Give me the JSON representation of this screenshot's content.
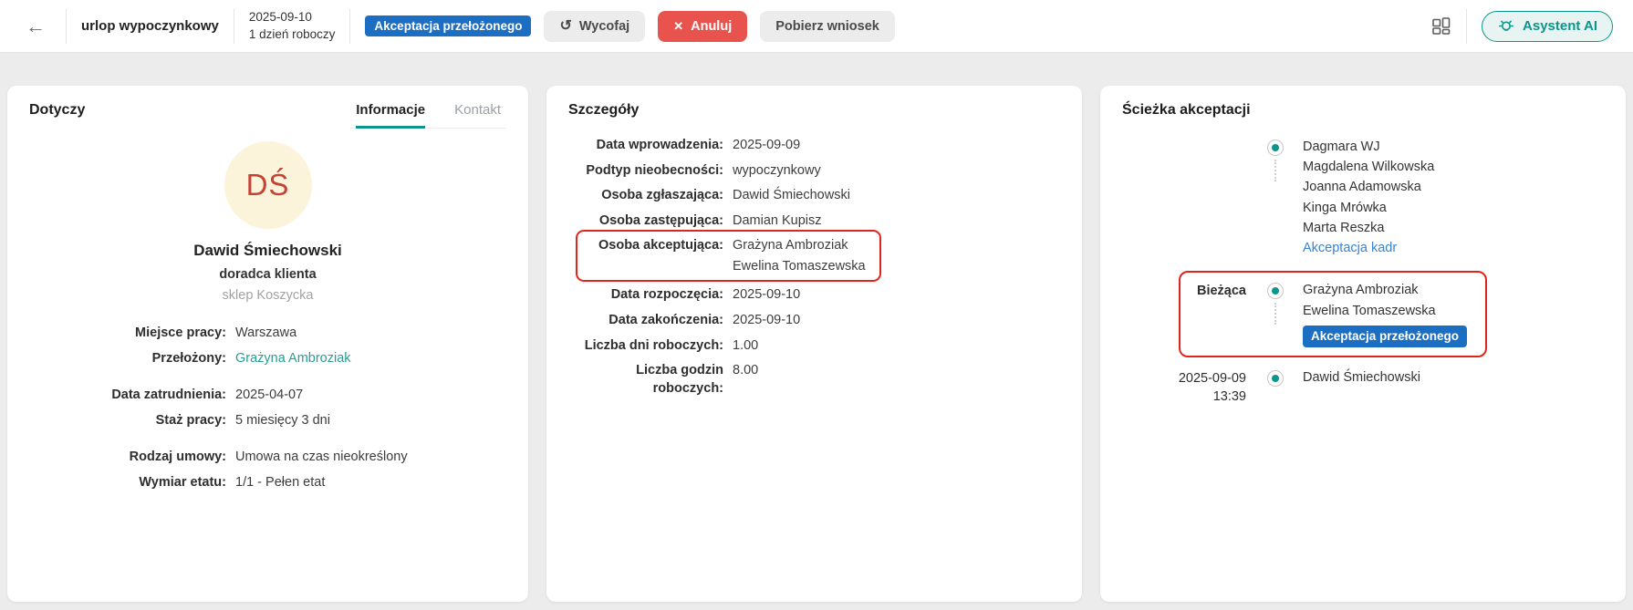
{
  "colors": {
    "accent_teal": "#0a968c",
    "badge_blue": "#1b6ec2",
    "link_blue": "#3583d6",
    "link_teal": "#2a9d93",
    "danger_red": "#e8534d",
    "annotation_red": "#e0261c",
    "avatar_bg": "#fbf3da",
    "avatar_text": "#c64234"
  },
  "topbar": {
    "back_icon": "←",
    "title": "urlop wypoczynkowy",
    "date": "2025-09-10",
    "duration": "1 dzień roboczy",
    "status_badge": "Akceptacja przełożonego",
    "withdraw_label": "Wycofaj",
    "withdraw_icon": "↺",
    "cancel_label": "Anuluj",
    "cancel_icon": "✕",
    "download_label": "Pobierz wniosek",
    "assistant_label": "Asystent AI"
  },
  "dotyczy": {
    "title": "Dotyczy",
    "tabs": [
      {
        "label": "Informacje",
        "active": true
      },
      {
        "label": "Kontakt",
        "active": false
      }
    ],
    "avatar_initials": "DŚ",
    "name": "Dawid Śmiechowski",
    "role": "doradca klienta",
    "unit": "sklep Koszycka",
    "groups": [
      [
        {
          "label": "Miejsce pracy:",
          "value": "Warszawa"
        },
        {
          "label": "Przełożony:",
          "value": "Grażyna Ambroziak",
          "link": true
        }
      ],
      [
        {
          "label": "Data zatrudnienia:",
          "value": "2025-04-07"
        },
        {
          "label": "Staż pracy:",
          "value": "5 miesięcy 3 dni"
        }
      ],
      [
        {
          "label": "Rodzaj umowy:",
          "value": "Umowa na czas nieokreślony"
        },
        {
          "label": "Wymiar etatu:",
          "value": "1/1 - Pełen etat"
        }
      ]
    ]
  },
  "szczegoly": {
    "title": "Szczegóły",
    "fields": [
      {
        "label": "Data wprowadzenia:",
        "value": "2025-09-09"
      },
      {
        "label": "Podtyp nieobecności:",
        "value": "wypoczynkowy"
      },
      {
        "label": "Osoba zgłaszająca:",
        "value": "Dawid Śmiechowski"
      },
      {
        "label": "Osoba zastępująca:",
        "value": "Damian Kupisz"
      },
      {
        "label": "Osoba akceptująca:",
        "value": "Grażyna Ambroziak",
        "value2": "Ewelina Tomaszewska",
        "highlighted": true
      },
      {
        "label": "Data rozpoczęcia:",
        "value": "2025-09-10"
      },
      {
        "label": "Data zakończenia:",
        "value": "2025-09-10"
      },
      {
        "label": "Liczba dni roboczych:",
        "value": "1.00"
      },
      {
        "label": "Liczba godzin roboczych:",
        "value": "8.00"
      }
    ]
  },
  "sciezka": {
    "title": "Ścieżka akceptacji",
    "steps": [
      {
        "label": "",
        "names": [
          "Dagmara WJ",
          "Magdalena Wilkowska",
          "Joanna Adamowska",
          "Kinga Mrówka",
          "Marta Reszka"
        ],
        "status": "Akceptacja kadr",
        "status_type": "link"
      },
      {
        "label": "Bieżąca",
        "names": [
          "Grażyna Ambroziak",
          "Ewelina Tomaszewska"
        ],
        "status": "Akceptacja przełożonego",
        "status_type": "badge",
        "highlighted": true
      },
      {
        "label": "2025-09-09",
        "time": "13:39",
        "names": [
          "Dawid Śmiechowski"
        ]
      }
    ]
  }
}
